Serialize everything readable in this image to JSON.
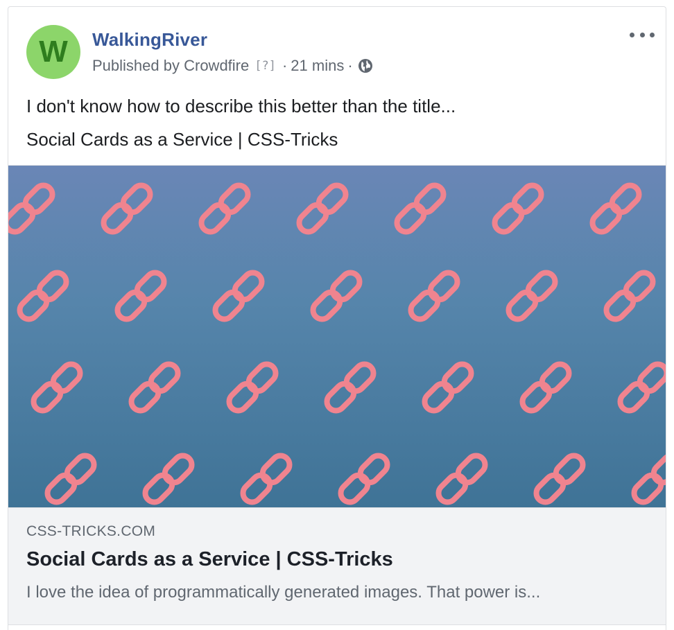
{
  "post": {
    "page_name": "WalkingRiver",
    "avatar_letter": "W",
    "published_by_prefix": "Published by",
    "publisher": "Crowdfire",
    "help_mark": "[?]",
    "dot": "·",
    "time": "21 mins",
    "audience_icon": "globe-icon",
    "menu_icon": "more-options-icon",
    "text": "I don't know how to describe this better than the title...",
    "shared_title": "Social Cards as a Service | CSS-Tricks"
  },
  "link_preview": {
    "domain": "CSS-TRICKS.COM",
    "title": "Social Cards as a Service | CSS-Tricks",
    "description": "I love the idea of programmatically generated images. That power is...",
    "image_pattern_icon": "chain-link-icon"
  },
  "colors": {
    "brand_link": "#385898",
    "avatar_bg": "#8cd56a",
    "avatar_fg": "#2e7d1e",
    "chain_pink": "#f0848f",
    "image_top": "#6a86b6",
    "image_bottom": "#3f7396",
    "preview_bg": "#f2f3f5"
  }
}
